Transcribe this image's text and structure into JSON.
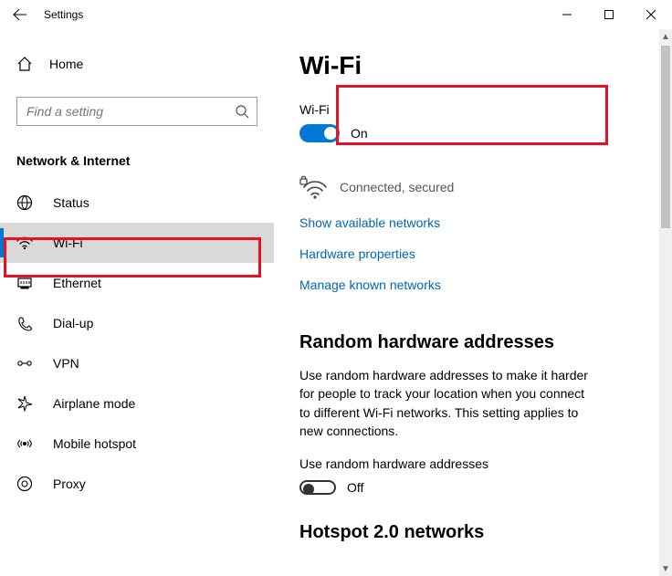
{
  "titlebar": {
    "title": "Settings"
  },
  "sidebar": {
    "home_label": "Home",
    "search_placeholder": "Find a setting",
    "category": "Network & Internet",
    "items": [
      {
        "label": "Status"
      },
      {
        "label": "Wi-Fi"
      },
      {
        "label": "Ethernet"
      },
      {
        "label": "Dial-up"
      },
      {
        "label": "VPN"
      },
      {
        "label": "Airplane mode"
      },
      {
        "label": "Mobile hotspot"
      },
      {
        "label": "Proxy"
      }
    ]
  },
  "content": {
    "page_title": "Wi-Fi",
    "wifi_toggle": {
      "label": "Wi-Fi",
      "state_text": "On"
    },
    "connection_status": "Connected, secured",
    "links": {
      "show_networks": "Show available networks",
      "hw_props": "Hardware properties",
      "manage_known": "Manage known networks"
    },
    "random_hw": {
      "heading": "Random hardware addresses",
      "body": "Use random hardware addresses to make it harder for people to track your location when you connect to different Wi-Fi networks. This setting applies to new connections.",
      "toggle_label": "Use random hardware addresses",
      "toggle_state_text": "Off"
    },
    "hotspot_heading": "Hotspot 2.0 networks"
  }
}
